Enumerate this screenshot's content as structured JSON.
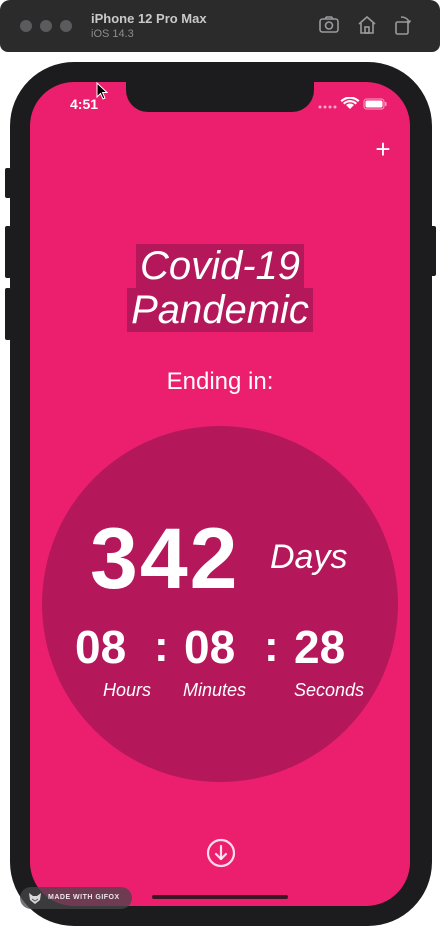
{
  "simulator": {
    "device_name": "iPhone 12 Pro Max",
    "os_version": "iOS 14.3",
    "toolbar_icons": [
      "screenshot-icon",
      "home-icon",
      "rotate-icon"
    ]
  },
  "status_bar": {
    "time": "4:51",
    "icons": [
      "signal-icon",
      "wifi-icon",
      "battery-icon"
    ]
  },
  "header": {
    "add_label": "+"
  },
  "title": {
    "line1": "Covid-19 ",
    "line2": "Pandemic"
  },
  "countdown": {
    "subtitle": "Ending in:",
    "days_value": "342",
    "days_unit": "Days",
    "hours_value": "08",
    "minutes_value": "08",
    "seconds_value": "28",
    "separator": ":",
    "hours_label": "Hours",
    "minutes_label": "Minutes",
    "seconds_label": "Seconds"
  },
  "footer": {
    "download_icon": "arrow-down-circle-icon"
  },
  "watermark": {
    "text": "MADE WITH GIFOX"
  },
  "colors": {
    "background": "#ec1f6f",
    "circle": "#b4185b",
    "text": "#ffffff"
  }
}
